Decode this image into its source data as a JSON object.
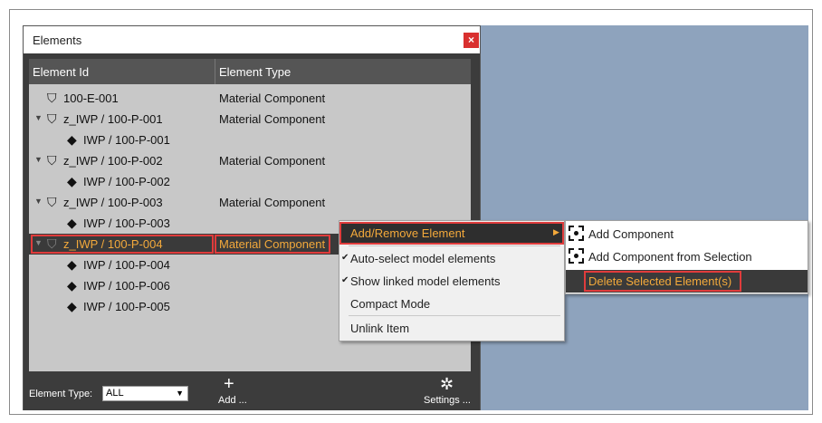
{
  "panel": {
    "title": "Elements",
    "close_label": "×"
  },
  "grid": {
    "columns": [
      "Element Id",
      "Element Type"
    ],
    "rows": [
      {
        "id": "100-E-001",
        "type": "Material Component",
        "caret": "",
        "icon": "tag-outline-icon"
      },
      {
        "id": "z_IWP / 100-P-001",
        "type": "Material Component",
        "caret": "▼",
        "icon": "tag-outline-icon"
      },
      {
        "id": "IWP / 100-P-001",
        "type": "",
        "caret": "",
        "icon": "tag-filled-icon"
      },
      {
        "id": "z_IWP / 100-P-002",
        "type": "Material Component",
        "caret": "▼",
        "icon": "tag-outline-icon"
      },
      {
        "id": "IWP / 100-P-002",
        "type": "",
        "caret": "",
        "icon": "tag-filled-icon"
      },
      {
        "id": "z_IWP / 100-P-003",
        "type": "Material Component",
        "caret": "▼",
        "icon": "tag-outline-icon"
      },
      {
        "id": "IWP / 100-P-003",
        "type": "",
        "caret": "",
        "icon": "tag-filled-icon"
      },
      {
        "id": "z_IWP / 100-P-004",
        "type": "Material Component",
        "caret": "▼",
        "icon": "tag-outline-icon",
        "selected": true
      },
      {
        "id": "IWP / 100-P-004",
        "type": "",
        "caret": "",
        "icon": "tag-filled-icon"
      },
      {
        "id": "IWP / 100-P-006",
        "type": "",
        "caret": "",
        "icon": "tag-filled-icon"
      },
      {
        "id": "IWP / 100-P-005",
        "type": "",
        "caret": "",
        "icon": "tag-filled-icon"
      }
    ]
  },
  "bottombar": {
    "type_label": "Element Type:",
    "type_value": "ALL",
    "add_label": "Add ...",
    "settings_label": "Settings ..."
  },
  "context_menu": {
    "items": [
      {
        "label": "Add/Remove Element",
        "checked": false,
        "highlighted": true
      },
      {
        "label": "Auto-select model elements",
        "checked": true
      },
      {
        "label": "Show linked model elements",
        "checked": true
      },
      {
        "label": "Compact Mode",
        "checked": false
      },
      {
        "label": "Unlink Item",
        "checked": false
      }
    ]
  },
  "submenu": {
    "items": [
      {
        "label": "Add Component"
      },
      {
        "label": "Add Component from Selection"
      },
      {
        "label": "Delete Selected Element(s)",
        "highlighted": true
      }
    ]
  },
  "colors": {
    "accent": "#f3a93b",
    "highlight_border": "#e03c3c",
    "viewport": "#8ea3bd"
  }
}
